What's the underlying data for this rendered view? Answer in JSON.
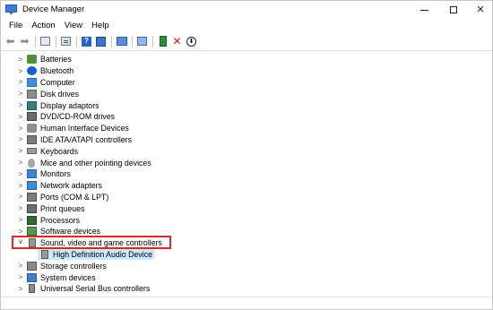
{
  "window": {
    "title": "Device Manager",
    "controls": {
      "minimize": "—",
      "maximize": "",
      "close": "✕"
    }
  },
  "menu": {
    "items": [
      "File",
      "Action",
      "View",
      "Help"
    ]
  },
  "toolbar": {
    "buttons": [
      {
        "name": "back",
        "icon": "arrow-left-icon"
      },
      {
        "name": "forward",
        "icon": "arrow-right-icon"
      },
      {
        "name": "show-hide-console-tree",
        "icon": "console-tree-icon"
      },
      {
        "name": "properties",
        "icon": "properties-icon"
      },
      {
        "name": "help",
        "icon": "help-icon",
        "glyph": "?"
      },
      {
        "name": "show-action-pane",
        "icon": "action-pane-icon"
      },
      {
        "name": "scan-hardware",
        "icon": "scan-icon"
      },
      {
        "name": "monitor",
        "icon": "monitor-icon"
      },
      {
        "name": "update-driver",
        "icon": "update-driver-icon"
      },
      {
        "name": "uninstall-device",
        "icon": "uninstall-icon",
        "glyph": "✕"
      },
      {
        "name": "download",
        "icon": "download-icon",
        "glyph": "⬇"
      }
    ]
  },
  "tree": {
    "items": [
      {
        "label": "Batteries",
        "icon": "battery-icon",
        "expanded": false
      },
      {
        "label": "Bluetooth",
        "icon": "bluetooth-icon",
        "expanded": false
      },
      {
        "label": "Computer",
        "icon": "computer-icon",
        "expanded": false
      },
      {
        "label": "Disk drives",
        "icon": "disk-drive-icon",
        "expanded": false
      },
      {
        "label": "Display adaptors",
        "icon": "display-adaptor-icon",
        "expanded": false
      },
      {
        "label": "DVD/CD-ROM drives",
        "icon": "dvd-drive-icon",
        "expanded": false
      },
      {
        "label": "Human Interface Devices",
        "icon": "hid-icon",
        "expanded": false
      },
      {
        "label": "IDE ATA/ATAPI controllers",
        "icon": "ide-controller-icon",
        "expanded": false
      },
      {
        "label": "Keyboards",
        "icon": "keyboard-icon",
        "expanded": false
      },
      {
        "label": "Mice and other pointing devices",
        "icon": "mouse-icon",
        "expanded": false
      },
      {
        "label": "Monitors",
        "icon": "monitor-icon",
        "expanded": false
      },
      {
        "label": "Network adapters",
        "icon": "network-adapter-icon",
        "expanded": false
      },
      {
        "label": "Ports (COM & LPT)",
        "icon": "port-icon",
        "expanded": false
      },
      {
        "label": "Print queues",
        "icon": "printer-icon",
        "expanded": false
      },
      {
        "label": "Processors",
        "icon": "processor-icon",
        "expanded": false
      },
      {
        "label": "Software devices",
        "icon": "software-device-icon",
        "expanded": false
      },
      {
        "label": "Sound, video and game controllers",
        "icon": "sound-icon",
        "expanded": true,
        "children": [
          {
            "label": "High Definition Audio Device",
            "icon": "audio-device-icon",
            "selected": true
          }
        ]
      },
      {
        "label": "Storage controllers",
        "icon": "storage-controller-icon",
        "expanded": false
      },
      {
        "label": "System devices",
        "icon": "system-device-icon",
        "expanded": false
      },
      {
        "label": "Universal Serial Bus controllers",
        "icon": "usb-icon",
        "expanded": false
      }
    ]
  },
  "colors": {
    "highlight_border": "#d42a2a",
    "selection": "#cce8ff",
    "uninstall": "#d11818"
  }
}
